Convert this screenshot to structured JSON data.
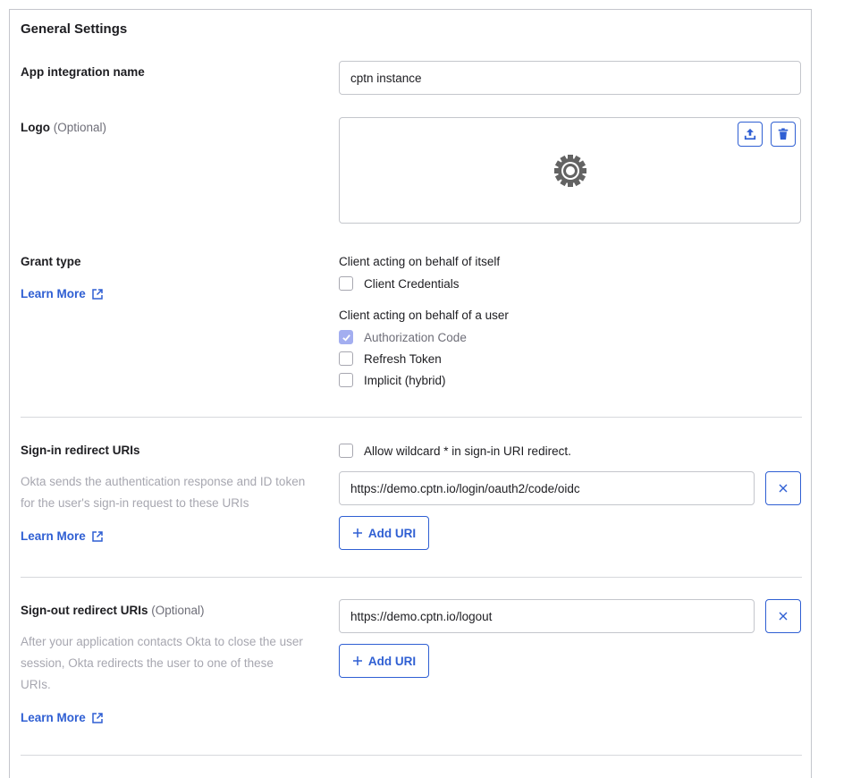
{
  "section_title": "General Settings",
  "colors": {
    "accent": "#2f5fd3",
    "border": "#c4c6cc",
    "muted_text": "#a7a7b0",
    "checked_disabled": "#a3aef0"
  },
  "app_name": {
    "label": "App integration name",
    "value": "cptn instance"
  },
  "logo": {
    "label": "Logo",
    "optional": "(Optional)",
    "placeholder_icon": "gear-icon",
    "upload_icon": "upload-icon",
    "delete_icon": "trash-icon"
  },
  "grant_type": {
    "label": "Grant type",
    "learn_more": "Learn More",
    "group1_title": "Client acting on behalf of itself",
    "group1_options": [
      {
        "label": "Client Credentials",
        "checked": false,
        "disabled": false
      }
    ],
    "group2_title": "Client acting on behalf of a user",
    "group2_options": [
      {
        "label": "Authorization Code",
        "checked": true,
        "disabled": true
      },
      {
        "label": "Refresh Token",
        "checked": false,
        "disabled": false
      },
      {
        "label": "Implicit (hybrid)",
        "checked": false,
        "disabled": false
      }
    ]
  },
  "signin": {
    "label": "Sign-in redirect URIs",
    "description": "Okta sends the authentication response and ID token for the user's sign-in request to these URIs",
    "learn_more": "Learn More",
    "wildcard_label": "Allow wildcard * in sign-in URI redirect.",
    "wildcard_checked": false,
    "uris": [
      "https://demo.cptn.io/login/oauth2/code/oidc"
    ],
    "add_label": "Add URI"
  },
  "signout": {
    "label": "Sign-out redirect URIs",
    "optional": "(Optional)",
    "description": "After your application contacts Okta to close the user session, Okta redirects the user to one of these URIs.",
    "learn_more": "Learn More",
    "uris": [
      "https://demo.cptn.io/logout"
    ],
    "add_label": "Add URI"
  }
}
